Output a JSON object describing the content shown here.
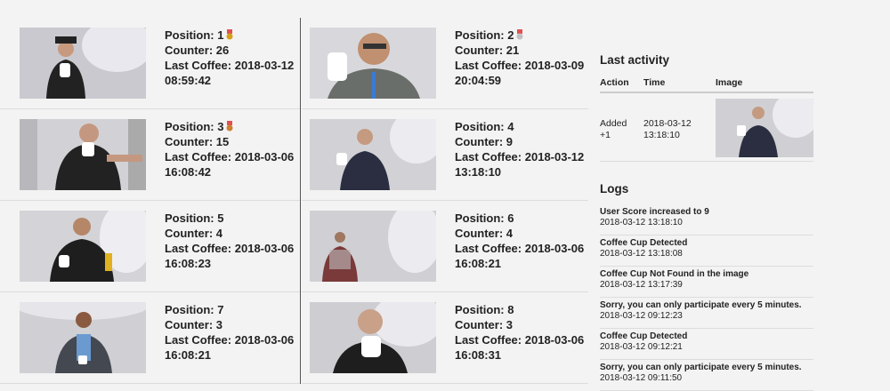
{
  "leaderboard": {
    "labels": {
      "position": "Position:",
      "counter": "Counter:",
      "last_coffee": "Last Coffee:"
    },
    "entries": [
      {
        "position": "1",
        "counter": "26",
        "last_coffee_date": "2018-03-12",
        "last_coffee_time": "08:59:42",
        "medal": "gold-medal-icon"
      },
      {
        "position": "2",
        "counter": "21",
        "last_coffee_date": "2018-03-09",
        "last_coffee_time": "20:04:59",
        "medal": "silver-medal-icon"
      },
      {
        "position": "3",
        "counter": "15",
        "last_coffee_date": "2018-03-06",
        "last_coffee_time": "16:08:42",
        "medal": "bronze-medal-icon"
      },
      {
        "position": "4",
        "counter": "9",
        "last_coffee_date": "2018-03-12",
        "last_coffee_time": "13:18:10"
      },
      {
        "position": "5",
        "counter": "4",
        "last_coffee_date": "2018-03-06",
        "last_coffee_time": "16:08:23"
      },
      {
        "position": "6",
        "counter": "4",
        "last_coffee_date": "2018-03-06",
        "last_coffee_time": "16:08:21"
      },
      {
        "position": "7",
        "counter": "3",
        "last_coffee_date": "2018-03-06",
        "last_coffee_time": "16:08:21"
      },
      {
        "position": "8",
        "counter": "3",
        "last_coffee_date": "2018-03-06",
        "last_coffee_time": "16:08:31"
      }
    ]
  },
  "last_activity": {
    "title": "Last activity",
    "headers": {
      "action": "Action",
      "time": "Time",
      "image": "Image"
    },
    "row": {
      "action_line1": "Added",
      "action_line2": "+1",
      "time_line1": "2018-03-12",
      "time_line2": "13:18:10"
    }
  },
  "logs": {
    "title": "Logs",
    "items": [
      {
        "message": "User Score increased to 9",
        "timestamp": "2018-03-12 13:18:10"
      },
      {
        "message": "Coffee Cup Detected",
        "timestamp": "2018-03-12 13:18:08"
      },
      {
        "message": "Coffee Cup Not Found in the image",
        "timestamp": "2018-03-12 13:17:39"
      },
      {
        "message": "Sorry, you can only participate every 5 minutes.",
        "timestamp": "2018-03-12 09:12:23"
      },
      {
        "message": "Coffee Cup Detected",
        "timestamp": "2018-03-12 09:12:21"
      },
      {
        "message": "Sorry, you can only participate every 5 minutes.",
        "timestamp": "2018-03-12 09:11:50"
      }
    ]
  },
  "colors": {
    "gold": "#d4a017",
    "silver": "#c0c0c0",
    "bronze": "#cd7f32",
    "ribbon": "#e05050"
  }
}
